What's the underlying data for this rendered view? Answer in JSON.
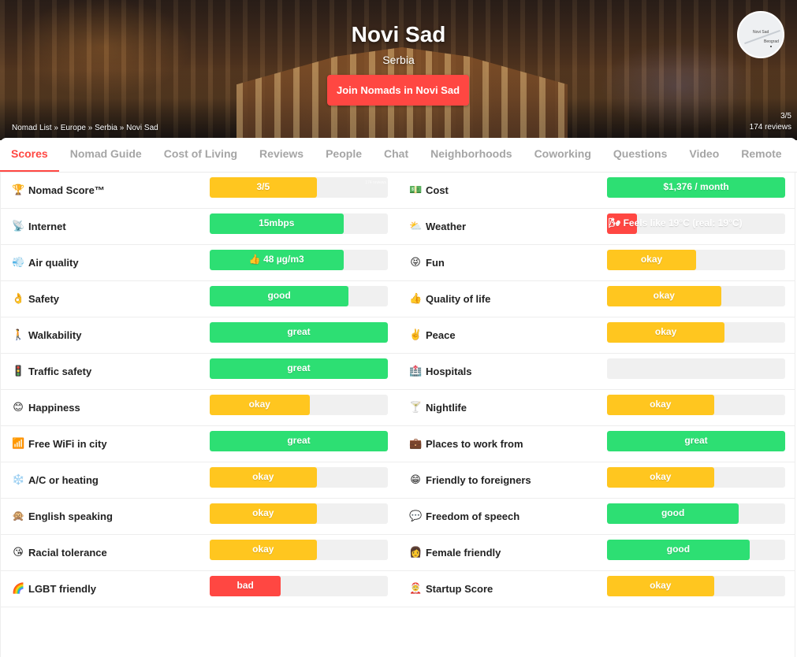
{
  "hero": {
    "city": "Novi Sad",
    "country": "Serbia",
    "join_label": "Join Nomads in Novi Sad",
    "breadcrumb": [
      "Nomad List",
      "Europe",
      "Serbia",
      "Novi Sad"
    ],
    "breadcrumb_sep": "»",
    "rating": "3/5",
    "reviews": "174 reviews",
    "map": {
      "label_1": "Novi Sad",
      "label_2": "Beograd"
    }
  },
  "tabs": [
    {
      "label": "Scores",
      "active": true
    },
    {
      "label": "Nomad Guide"
    },
    {
      "label": "Cost of Living"
    },
    {
      "label": "Reviews"
    },
    {
      "label": "People"
    },
    {
      "label": "Chat"
    },
    {
      "label": "Neighborhoods"
    },
    {
      "label": "Coworking"
    },
    {
      "label": "Questions"
    },
    {
      "label": "Video"
    },
    {
      "label": "Remote"
    }
  ],
  "colors": {
    "brand": "#ff4742",
    "green": "#2ddf73",
    "yellow": "#ffc61f",
    "red": "#ff4742",
    "track": "#f0f0f0"
  },
  "scores": [
    {
      "left": {
        "label": "Nomad Score™",
        "icon": "🏆",
        "icon_name": "trophy-icon",
        "value": "3/5",
        "fill": 0.6,
        "color": "yellow",
        "sub": "174 reviews"
      },
      "right": {
        "label": "Cost",
        "icon": "💵",
        "icon_name": "money-icon",
        "value": "$1,376 / month",
        "fill": 1.0,
        "color": "green"
      }
    },
    {
      "left": {
        "label": "Internet",
        "icon": "📡",
        "icon_name": "satellite-icon",
        "value": "15mbps",
        "fill": 0.75,
        "color": "green"
      },
      "right": {
        "label": "Weather",
        "icon": "⛅",
        "icon_name": "cloud-sun-icon",
        "value": "🌬 Feels like 19°C (real: 19°C)",
        "fill": 0.17,
        "color": "red",
        "text_align": "left"
      }
    },
    {
      "left": {
        "label": "Air quality",
        "icon": "💨",
        "icon_name": "wind-icon",
        "value": "👍 48 µg/m3",
        "fill": 0.75,
        "color": "green"
      },
      "right": {
        "label": "Fun",
        "icon": "😝",
        "icon_name": "fun-face-icon",
        "value": "okay",
        "fill": 0.5,
        "color": "yellow"
      }
    },
    {
      "left": {
        "label": "Safety",
        "icon": "👌",
        "icon_name": "ok-hand-icon",
        "value": "good",
        "fill": 0.78,
        "color": "green"
      },
      "right": {
        "label": "Quality of life",
        "icon": "👍",
        "icon_name": "thumbs-up-icon",
        "value": "okay",
        "fill": 0.64,
        "color": "yellow"
      }
    },
    {
      "left": {
        "label": "Walkability",
        "icon": "🚶",
        "icon_name": "walking-icon",
        "value": "great",
        "fill": 1.0,
        "color": "green"
      },
      "right": {
        "label": "Peace",
        "icon": "✌️",
        "icon_name": "peace-hand-icon",
        "value": "okay",
        "fill": 0.66,
        "color": "yellow"
      }
    },
    {
      "left": {
        "label": "Traffic safety",
        "icon": "🚦",
        "icon_name": "traffic-light-icon",
        "value": "great",
        "fill": 1.0,
        "color": "green"
      },
      "right": {
        "label": "Hospitals",
        "icon": "🏥",
        "icon_name": "hospital-icon",
        "value": "",
        "fill": 0.0,
        "color": "green"
      }
    },
    {
      "left": {
        "label": "Happiness",
        "icon": "😊",
        "icon_name": "happy-face-icon",
        "value": "okay",
        "fill": 0.56,
        "color": "yellow"
      },
      "right": {
        "label": "Nightlife",
        "icon": "🍸",
        "icon_name": "cocktail-icon",
        "value": "okay",
        "fill": 0.6,
        "color": "yellow"
      }
    },
    {
      "left": {
        "label": "Free WiFi in city",
        "icon": "📶",
        "icon_name": "wifi-icon",
        "value": "great",
        "fill": 1.0,
        "color": "green"
      },
      "right": {
        "label": "Places to work from",
        "icon": "💼",
        "icon_name": "briefcase-icon",
        "value": "great",
        "fill": 1.0,
        "color": "green"
      }
    },
    {
      "left": {
        "label": "A/C or heating",
        "icon": "❄️",
        "icon_name": "snowflake-icon",
        "value": "okay",
        "fill": 0.6,
        "color": "yellow"
      },
      "right": {
        "label": "Friendly to foreigners",
        "icon": "😁",
        "icon_name": "grinning-face-icon",
        "value": "okay",
        "fill": 0.6,
        "color": "yellow"
      }
    },
    {
      "left": {
        "label": "English speaking",
        "icon": "🙊",
        "icon_name": "monkey-icon",
        "value": "okay",
        "fill": 0.6,
        "color": "yellow"
      },
      "right": {
        "label": "Freedom of speech",
        "icon": "💬",
        "icon_name": "speech-icon",
        "value": "good",
        "fill": 0.74,
        "color": "green"
      }
    },
    {
      "left": {
        "label": "Racial tolerance",
        "icon": "😘",
        "icon_name": "kiss-face-icon",
        "value": "okay",
        "fill": 0.6,
        "color": "yellow"
      },
      "right": {
        "label": "Female friendly",
        "icon": "👩",
        "icon_name": "woman-icon",
        "value": "good",
        "fill": 0.8,
        "color": "green"
      }
    },
    {
      "left": {
        "label": "LGBT friendly",
        "icon": "🌈",
        "icon_name": "rainbow-icon",
        "value": "bad",
        "fill": 0.4,
        "color": "red"
      },
      "right": {
        "label": "Startup Score",
        "icon": "🤶",
        "icon_name": "startup-icon",
        "value": "okay",
        "fill": 0.6,
        "color": "yellow"
      }
    }
  ]
}
